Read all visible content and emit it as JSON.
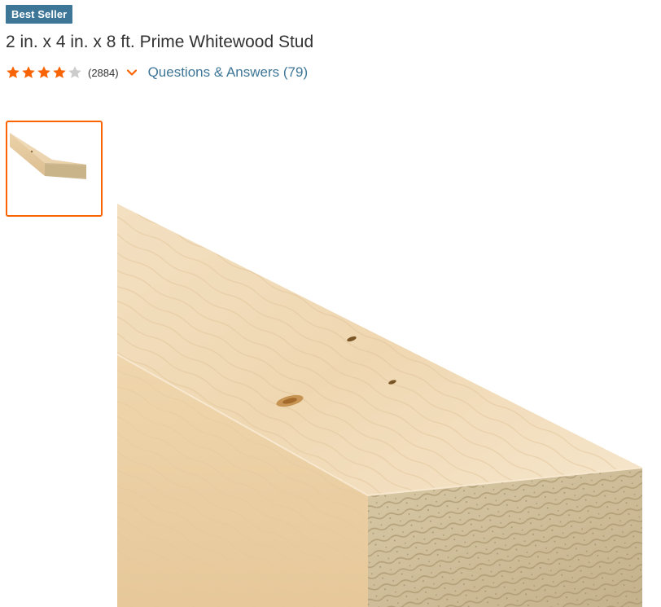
{
  "badge": {
    "label": "Best Seller"
  },
  "product": {
    "title": "2 in. x 4 in. x 8 ft. Prime Whitewood Stud"
  },
  "rating": {
    "value": 4,
    "max": 5,
    "count_label": "(2884)",
    "star_color": "#f96302",
    "empty_star_color": "#cccccc"
  },
  "qa": {
    "label": "Questions & Answers (79)"
  },
  "colors": {
    "badge_bg": "#3e7697",
    "link": "#3e7697",
    "accent": "#f96302"
  },
  "icons": {
    "star": "star-icon",
    "chevron": "chevron-down-icon"
  }
}
